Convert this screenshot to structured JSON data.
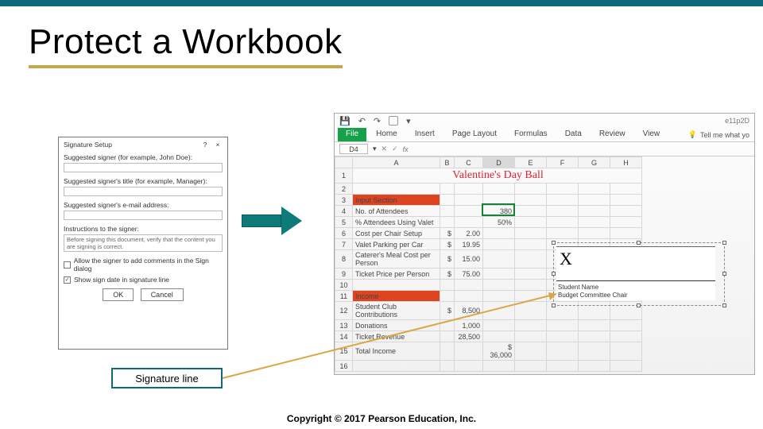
{
  "slide": {
    "title": "Protect a Workbook",
    "callout": "Signature line",
    "copyright": "Copyright © 2017 Pearson Education, Inc."
  },
  "dialog": {
    "title": "Signature Setup",
    "help": "?",
    "close": "×",
    "label_signer": "Suggested signer (for example, John Doe):",
    "label_title": "Suggested signer's title (for example, Manager):",
    "label_email": "Suggested signer's e-mail address:",
    "label_instructions": "Instructions to the signer:",
    "instructions_default": "Before signing this document, verify that the content you are signing is correct.",
    "chk_comments": "Allow the signer to add comments in the Sign dialog",
    "chk_date": "Show sign date in signature line",
    "ok": "OK",
    "cancel": "Cancel"
  },
  "excel": {
    "doc_name": "e11p2D",
    "qat": {
      "save": "💾",
      "undo": "↶",
      "redo": "↷",
      "more": "▾"
    },
    "tabs": [
      "File",
      "Home",
      "Insert",
      "Page Layout",
      "Formulas",
      "Data",
      "Review",
      "View"
    ],
    "tell_me": "Tell me what yo",
    "namebox": "D4",
    "fx": "fx",
    "cols": [
      "",
      "A",
      "B",
      "C",
      "D",
      "E",
      "F",
      "G",
      "H"
    ],
    "title_row": "Valentine's Day Ball",
    "rows": [
      {
        "n": "3",
        "a_class": "sect",
        "a": "Input Section"
      },
      {
        "n": "4",
        "a": "No. of Attendees",
        "c": "",
        "d": "380"
      },
      {
        "n": "5",
        "a": "% Attendees Using Valet",
        "d": "50%"
      },
      {
        "n": "6",
        "a": "Cost per Chair Setup",
        "b": "$",
        "c": "2.00"
      },
      {
        "n": "7",
        "a": "Valet Parking per Car",
        "b": "$",
        "c": "19.95"
      },
      {
        "n": "8",
        "a": "Caterer's Meal Cost per Person",
        "b": "$",
        "c": "15.00"
      },
      {
        "n": "9",
        "a": "Ticket Price per Person",
        "b": "$",
        "c": "75.00"
      },
      {
        "n": "10",
        "a": ""
      },
      {
        "n": "11",
        "a_class": "sect",
        "a": "Income"
      },
      {
        "n": "12",
        "a": "Student Club Contributions",
        "b": "$",
        "c": "8,500"
      },
      {
        "n": "13",
        "a": "Donations",
        "c": "1,000"
      },
      {
        "n": "14",
        "a": "Ticket Revenue",
        "c": "28,500"
      },
      {
        "n": "15",
        "a": "Total Income",
        "d_b": "$",
        "d": "36,000"
      },
      {
        "n": "16",
        "a": ""
      }
    ],
    "signature": {
      "mark": "X",
      "name": "Student Name",
      "role": "Budget Committee Chair"
    }
  }
}
